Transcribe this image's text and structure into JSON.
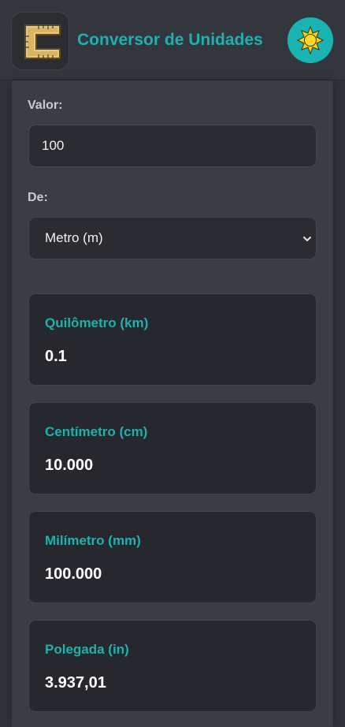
{
  "header": {
    "app_icon": "ruler-c-icon",
    "title": "Conversor de Unidades",
    "theme_toggle_icon": "sun-icon"
  },
  "form": {
    "value_label": "Valor:",
    "value": "100",
    "from_label": "De:",
    "from_unit": "Metro (m)"
  },
  "results": [
    {
      "label": "Quilômetro (km)",
      "value": "0.1"
    },
    {
      "label": "Centímetro (cm)",
      "value": "10.000"
    },
    {
      "label": "Milímetro (mm)",
      "value": "100.000"
    },
    {
      "label": "Polegada (in)",
      "value": "3.937,01"
    }
  ],
  "colors": {
    "accent": "#1fb0b0",
    "background": "#2f3238",
    "panel": "#3a3d43",
    "card": "#26282d",
    "sun": "#f2d21c"
  }
}
